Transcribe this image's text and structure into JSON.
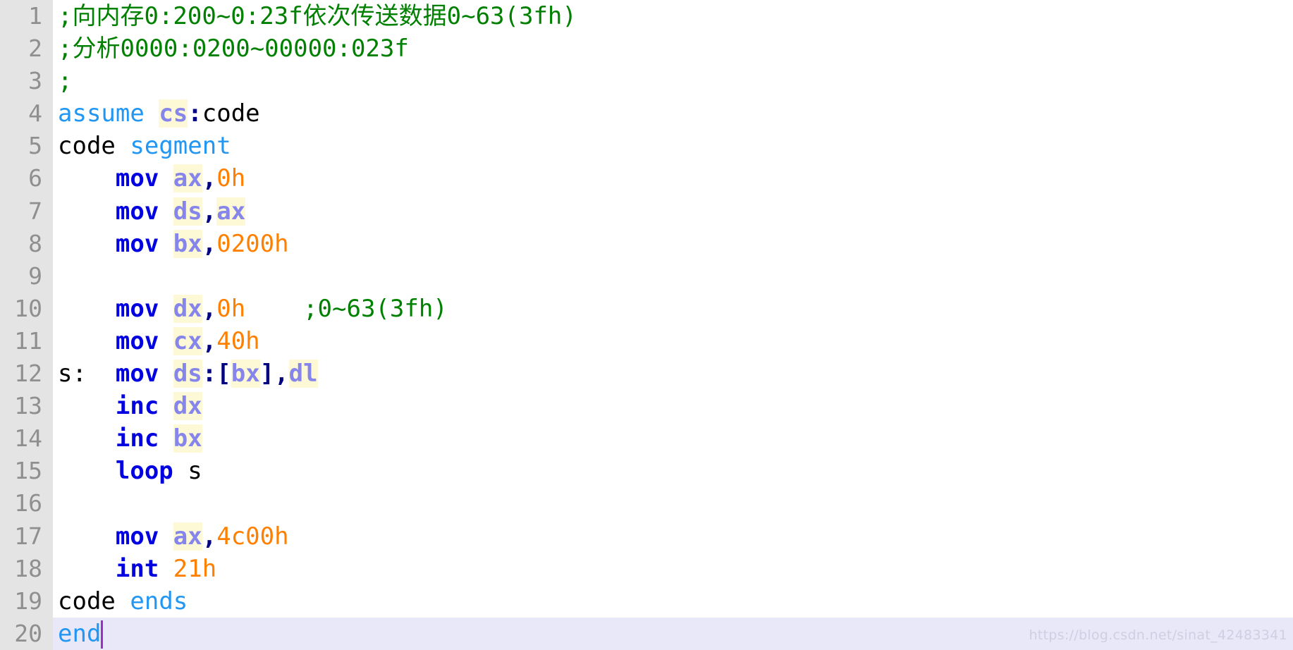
{
  "editor": {
    "language": "assembly",
    "total_lines": 20,
    "cursor_line": 20,
    "gutter_bg": "#e4e4e4",
    "line_number_color": "#8f8f8f",
    "current_line_bg": "#e8e8f8",
    "caret_color": "#9b30c8",
    "colors": {
      "comment": "#008000",
      "keyword": "#2196f3",
      "instruction": "#0000e0",
      "register": "#8585ec",
      "register_highlight": "#fdf8d5",
      "number": "#ff8000",
      "plain": "#000000",
      "punctuation": "#000080"
    }
  },
  "lines": [
    {
      "number": "1",
      "current": false,
      "tokens": [
        {
          "text": ";向内存0:200~0:23f依次传送数据0~63(3fh)",
          "type": "comment"
        }
      ]
    },
    {
      "number": "2",
      "current": false,
      "tokens": [
        {
          "text": ";分析0000:0200~00000:023f",
          "type": "comment"
        }
      ]
    },
    {
      "number": "3",
      "current": false,
      "tokens": [
        {
          "text": ";",
          "type": "comment"
        }
      ]
    },
    {
      "number": "4",
      "current": false,
      "tokens": [
        {
          "text": "assume",
          "type": "keyword"
        },
        {
          "text": " ",
          "type": "plain"
        },
        {
          "text": "cs",
          "type": "register"
        },
        {
          "text": ":",
          "type": "punctuation"
        },
        {
          "text": "code",
          "type": "plain"
        }
      ]
    },
    {
      "number": "5",
      "current": false,
      "tokens": [
        {
          "text": "code",
          "type": "plain"
        },
        {
          "text": " ",
          "type": "plain"
        },
        {
          "text": "segment",
          "type": "keyword"
        }
      ]
    },
    {
      "number": "6",
      "current": false,
      "tokens": [
        {
          "text": "    ",
          "type": "plain"
        },
        {
          "text": "mov",
          "type": "instruction"
        },
        {
          "text": " ",
          "type": "plain"
        },
        {
          "text": "ax",
          "type": "register"
        },
        {
          "text": ",",
          "type": "punctuation"
        },
        {
          "text": "0h",
          "type": "number"
        }
      ]
    },
    {
      "number": "7",
      "current": false,
      "tokens": [
        {
          "text": "    ",
          "type": "plain"
        },
        {
          "text": "mov",
          "type": "instruction"
        },
        {
          "text": " ",
          "type": "plain"
        },
        {
          "text": "ds",
          "type": "register"
        },
        {
          "text": ",",
          "type": "punctuation"
        },
        {
          "text": "ax",
          "type": "register"
        }
      ]
    },
    {
      "number": "8",
      "current": false,
      "tokens": [
        {
          "text": "    ",
          "type": "plain"
        },
        {
          "text": "mov",
          "type": "instruction"
        },
        {
          "text": " ",
          "type": "plain"
        },
        {
          "text": "bx",
          "type": "register"
        },
        {
          "text": ",",
          "type": "punctuation"
        },
        {
          "text": "0200h",
          "type": "number"
        }
      ]
    },
    {
      "number": "9",
      "current": false,
      "tokens": []
    },
    {
      "number": "10",
      "current": false,
      "tokens": [
        {
          "text": "    ",
          "type": "plain"
        },
        {
          "text": "mov",
          "type": "instruction"
        },
        {
          "text": " ",
          "type": "plain"
        },
        {
          "text": "dx",
          "type": "register"
        },
        {
          "text": ",",
          "type": "punctuation"
        },
        {
          "text": "0h",
          "type": "number"
        },
        {
          "text": "    ",
          "type": "plain"
        },
        {
          "text": ";0~63(3fh)",
          "type": "comment"
        }
      ]
    },
    {
      "number": "11",
      "current": false,
      "tokens": [
        {
          "text": "    ",
          "type": "plain"
        },
        {
          "text": "mov",
          "type": "instruction"
        },
        {
          "text": " ",
          "type": "plain"
        },
        {
          "text": "cx",
          "type": "register"
        },
        {
          "text": ",",
          "type": "punctuation"
        },
        {
          "text": "40h",
          "type": "number"
        }
      ]
    },
    {
      "number": "12",
      "current": false,
      "tokens": [
        {
          "text": "s:",
          "type": "plain"
        },
        {
          "text": "  ",
          "type": "plain"
        },
        {
          "text": "mov",
          "type": "instruction"
        },
        {
          "text": " ",
          "type": "plain"
        },
        {
          "text": "ds",
          "type": "register"
        },
        {
          "text": ":[",
          "type": "punctuation"
        },
        {
          "text": "bx",
          "type": "register"
        },
        {
          "text": "],",
          "type": "punctuation"
        },
        {
          "text": "dl",
          "type": "register"
        }
      ]
    },
    {
      "number": "13",
      "current": false,
      "tokens": [
        {
          "text": "    ",
          "type": "plain"
        },
        {
          "text": "inc",
          "type": "instruction"
        },
        {
          "text": " ",
          "type": "plain"
        },
        {
          "text": "dx",
          "type": "register"
        }
      ]
    },
    {
      "number": "14",
      "current": false,
      "tokens": [
        {
          "text": "    ",
          "type": "plain"
        },
        {
          "text": "inc",
          "type": "instruction"
        },
        {
          "text": " ",
          "type": "plain"
        },
        {
          "text": "bx",
          "type": "register"
        }
      ]
    },
    {
      "number": "15",
      "current": false,
      "tokens": [
        {
          "text": "    ",
          "type": "plain"
        },
        {
          "text": "loop",
          "type": "instruction"
        },
        {
          "text": " ",
          "type": "plain"
        },
        {
          "text": "s",
          "type": "plain"
        }
      ]
    },
    {
      "number": "16",
      "current": false,
      "tokens": []
    },
    {
      "number": "17",
      "current": false,
      "tokens": [
        {
          "text": "    ",
          "type": "plain"
        },
        {
          "text": "mov",
          "type": "instruction"
        },
        {
          "text": " ",
          "type": "plain"
        },
        {
          "text": "ax",
          "type": "register"
        },
        {
          "text": ",",
          "type": "punctuation"
        },
        {
          "text": "4c00h",
          "type": "number"
        }
      ]
    },
    {
      "number": "18",
      "current": false,
      "tokens": [
        {
          "text": "    ",
          "type": "plain"
        },
        {
          "text": "int",
          "type": "instruction"
        },
        {
          "text": " ",
          "type": "plain"
        },
        {
          "text": "21h",
          "type": "number"
        }
      ]
    },
    {
      "number": "19",
      "current": false,
      "tokens": [
        {
          "text": "code",
          "type": "plain"
        },
        {
          "text": " ",
          "type": "plain"
        },
        {
          "text": "ends",
          "type": "keyword"
        }
      ]
    },
    {
      "number": "20",
      "current": true,
      "caret_after_chars": 3,
      "tokens": [
        {
          "text": "end",
          "type": "keyword"
        }
      ]
    }
  ],
  "watermark": {
    "text": "https://blog.csdn.net/sinat_42483341"
  }
}
